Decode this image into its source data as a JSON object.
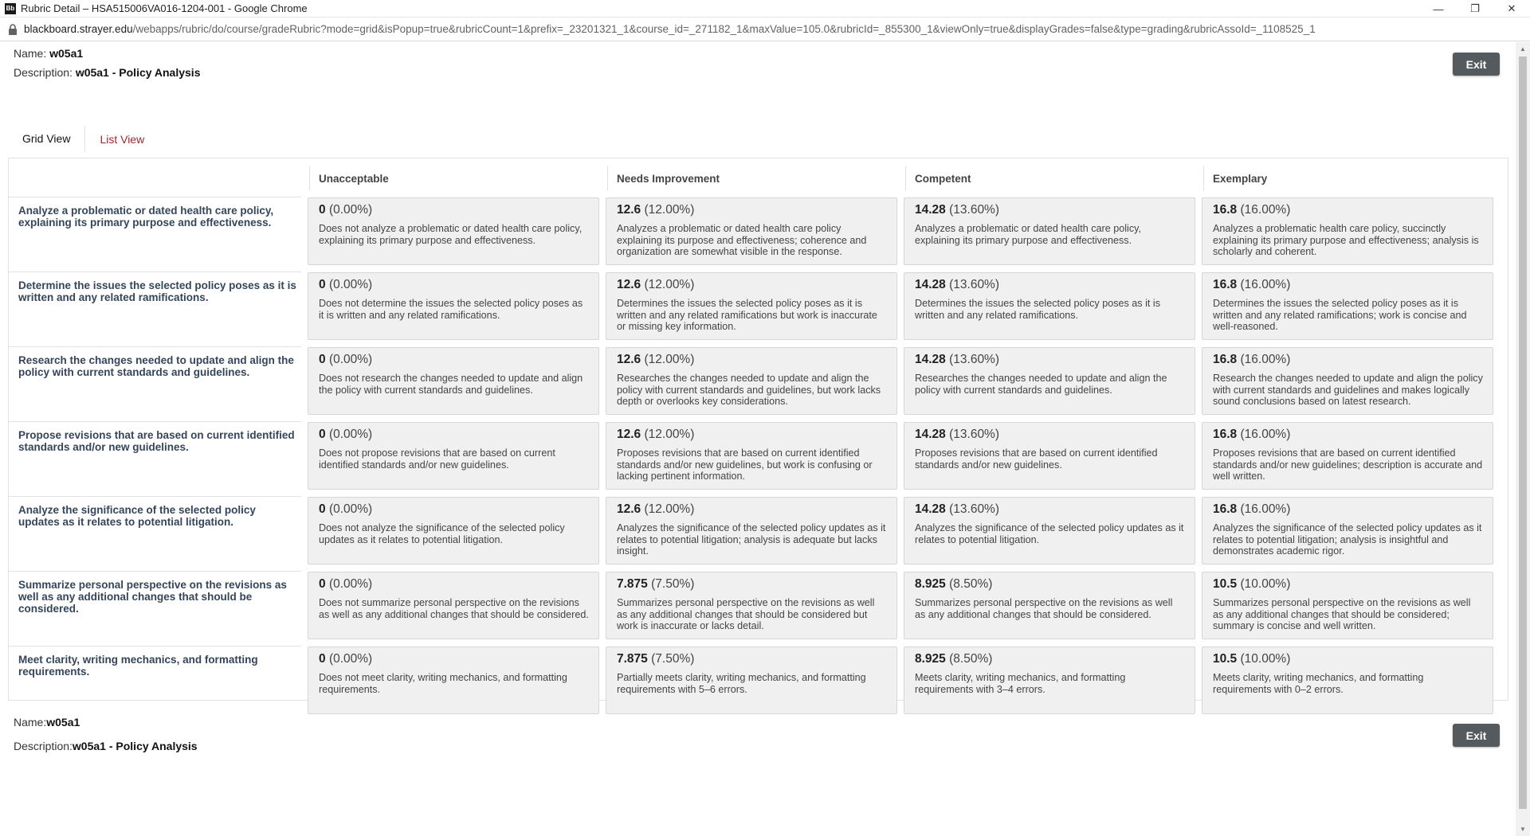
{
  "window": {
    "title": "Rubric Detail – HSA515006VA016-1204-001 - Google Chrome",
    "app_icon_text": "Bb",
    "url_host": "blackboard.strayer.edu",
    "url_path": "/webapps/rubric/do/course/gradeRubric?mode=grid&isPopup=true&rubricCount=1&prefix=_23201321_1&course_id=_271182_1&maxValue=105.0&rubricId=_855300_1&viewOnly=true&displayGrades=false&type=grading&rubricAssoId=_1108525_1"
  },
  "header": {
    "name_label": "Name:",
    "name_value": "w05a1",
    "description_label": "Description:",
    "description_value": "w05a1 - Policy Analysis",
    "exit_label": "Exit"
  },
  "tabs": [
    {
      "label": "Grid View",
      "active": true
    },
    {
      "label": "List View",
      "active": false
    }
  ],
  "levels": [
    "Unacceptable",
    "Needs Improvement",
    "Competent",
    "Exemplary"
  ],
  "criteria": [
    {
      "name": "Analyze a problematic or dated health care policy, explaining its primary purpose and effectiveness.",
      "cells": [
        {
          "score": "0",
          "pct": "(0.00%)",
          "desc": "Does not analyze a problematic or dated health care policy, explaining its primary purpose and effectiveness."
        },
        {
          "score": "12.6",
          "pct": "(12.00%)",
          "desc": "Analyzes a problematic or dated health care policy explaining its purpose and effectiveness; coherence and organization are somewhat visible in the response."
        },
        {
          "score": "14.28",
          "pct": "(13.60%)",
          "desc": "Analyzes a problematic or dated health care policy, explaining its primary purpose and effectiveness."
        },
        {
          "score": "16.8",
          "pct": "(16.00%)",
          "desc": "Analyzes a problematic health care policy, succinctly explaining its primary purpose and effectiveness; analysis is scholarly and coherent."
        }
      ]
    },
    {
      "name": "Determine the issues the selected policy poses as it is written and any related ramifications.",
      "cells": [
        {
          "score": "0",
          "pct": "(0.00%)",
          "desc": "Does not determine the issues the selected policy poses as it is written and any related ramifications."
        },
        {
          "score": "12.6",
          "pct": "(12.00%)",
          "desc": "Determines the issues the selected policy poses as it is written and any related ramifications but work is inaccurate or missing key information."
        },
        {
          "score": "14.28",
          "pct": "(13.60%)",
          "desc": "Determines the issues the selected policy poses as it is written and any related ramifications."
        },
        {
          "score": "16.8",
          "pct": "(16.00%)",
          "desc": "Determines the issues the selected policy poses as it is written and any related ramifications; work is concise and well-reasoned."
        }
      ]
    },
    {
      "name": "Research the changes needed to update and align the policy with current standards and guidelines.",
      "cells": [
        {
          "score": "0",
          "pct": "(0.00%)",
          "desc": "Does not research the changes needed to update and align the policy with current standards and guidelines."
        },
        {
          "score": "12.6",
          "pct": "(12.00%)",
          "desc": "Researches the changes needed to update and align the policy with current standards and guidelines, but work lacks depth or overlooks key considerations."
        },
        {
          "score": "14.28",
          "pct": "(13.60%)",
          "desc": "Researches the changes needed to update and align the policy with current standards and guidelines."
        },
        {
          "score": "16.8",
          "pct": "(16.00%)",
          "desc": "Research the changes needed to update and align the policy with current standards and guidelines and makes logically sound conclusions based on latest research."
        }
      ]
    },
    {
      "name": "Propose revisions that are based on current identified standards and/or new guidelines.",
      "cells": [
        {
          "score": "0",
          "pct": "(0.00%)",
          "desc": "Does not propose revisions that are based on current identified standards and/or new guidelines."
        },
        {
          "score": "12.6",
          "pct": "(12.00%)",
          "desc": "Proposes revisions that are based on current identified standards and/or new guidelines, but work is confusing or lacking pertinent information."
        },
        {
          "score": "14.28",
          "pct": "(13.60%)",
          "desc": "Proposes revisions that are based on current identified standards and/or new guidelines."
        },
        {
          "score": "16.8",
          "pct": "(16.00%)",
          "desc": "Proposes revisions that are based on current identified standards and/or new guidelines; description is accurate and well written."
        }
      ]
    },
    {
      "name": "Analyze the significance of the selected policy updates as it relates to potential litigation.",
      "cells": [
        {
          "score": "0",
          "pct": "(0.00%)",
          "desc": "Does not analyze the significance of the selected policy updates as it relates to potential litigation."
        },
        {
          "score": "12.6",
          "pct": "(12.00%)",
          "desc": "Analyzes the significance of the selected policy updates as it relates to potential litigation; analysis is adequate but lacks insight."
        },
        {
          "score": "14.28",
          "pct": "(13.60%)",
          "desc": "Analyzes the significance of the selected policy updates as it relates to potential litigation."
        },
        {
          "score": "16.8",
          "pct": "(16.00%)",
          "desc": "Analyzes the significance of the selected policy updates as it relates to potential litigation; analysis is insightful and demonstrates academic rigor."
        }
      ]
    },
    {
      "name": "Summarize personal perspective on the revisions as well as any additional changes that should be considered.",
      "cells": [
        {
          "score": "0",
          "pct": "(0.00%)",
          "desc": "Does not summarize personal perspective on the revisions as well as any additional changes that should be considered."
        },
        {
          "score": "7.875",
          "pct": "(7.50%)",
          "desc": "Summarizes personal perspective on the revisions as well as any additional changes that should be considered but work is inaccurate or lacks detail."
        },
        {
          "score": "8.925",
          "pct": "(8.50%)",
          "desc": "Summarizes personal perspective on the revisions as well as any additional changes that should be considered."
        },
        {
          "score": "10.5",
          "pct": "(10.00%)",
          "desc": "Summarizes personal perspective on the revisions as well as any additional changes that should be considered; summary is concise and well written."
        }
      ]
    },
    {
      "name": "Meet clarity, writing mechanics, and formatting requirements.",
      "cells": [
        {
          "score": "0",
          "pct": "(0.00%)",
          "desc": "Does not meet clarity, writing mechanics, and formatting requirements."
        },
        {
          "score": "7.875",
          "pct": "(7.50%)",
          "desc": "Partially meets clarity, writing mechanics, and formatting requirements with 5–6 errors."
        },
        {
          "score": "8.925",
          "pct": "(8.50%)",
          "desc": "Meets clarity, writing mechanics, and formatting requirements with 3–4 errors."
        },
        {
          "score": "10.5",
          "pct": "(10.00%)",
          "desc": "Meets clarity, writing mechanics, and formatting requirements with 0–2 errors."
        }
      ]
    }
  ]
}
